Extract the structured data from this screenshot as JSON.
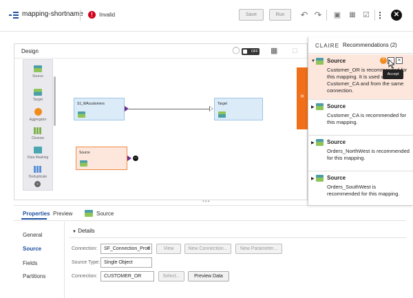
{
  "header": {
    "mapping_name": "mapping-shortname",
    "status": "Invalid",
    "save_label": "Save",
    "run_label": "Run",
    "icons": [
      "undo-icon",
      "redo-icon",
      "validate-icon",
      "parameters-icon",
      "check-icon",
      "more-vertical-icon",
      "close-icon"
    ]
  },
  "design": {
    "title": "Design",
    "toggle_label": "OFF",
    "palette": [
      {
        "label": "Source",
        "icon": "source-icon"
      },
      {
        "label": "Target",
        "icon": "target-icon"
      },
      {
        "label": "Aggregator",
        "icon": "aggregator-icon"
      },
      {
        "label": "Cleanse",
        "icon": "cleanse-icon"
      },
      {
        "label": "Data Masking",
        "icon": "data-masking-icon"
      },
      {
        "label": "Deduplicate",
        "icon": "deduplicate-icon"
      }
    ],
    "nodes": {
      "s1": "S1_WAcustomers",
      "target": "Target",
      "source": "Source"
    }
  },
  "recommendations": {
    "brand": "CLAIRE",
    "title": "Recommendations (2)",
    "tooltip": "Accept",
    "items": [
      {
        "name": "Source",
        "text": "Customer_OR is recommended for this mapping. It is used with Customer_CA and from the same connection.",
        "active": true
      },
      {
        "name": "Source",
        "text": "Customer_CA is recommended for this mapping.",
        "active": false
      },
      {
        "name": "Source",
        "text": "Orders_NorthWest is recommended for this mapping.",
        "active": false
      },
      {
        "name": "Source",
        "text": "Orders_SouthWest is recommended for this mapping.",
        "active": false
      }
    ]
  },
  "properties": {
    "tabs": [
      "Properties",
      "Preview"
    ],
    "source_tab": "Source",
    "nav": [
      "General",
      "Source",
      "Fields",
      "Partitions"
    ],
    "details_label": "Details",
    "fields": {
      "connection_label": "Connection:",
      "connection_value": "SF_Connection_Prod",
      "view_label": "View",
      "new_connection_label": "New Connection...",
      "new_parameter_label": "New Parameter...",
      "source_type_label": "Source Type:",
      "source_type_value": "Single Object",
      "object_label": "Connection:",
      "object_value": "CUSTOMER_OR",
      "select_label": "Select...",
      "preview_label": "Preview Data"
    }
  }
}
